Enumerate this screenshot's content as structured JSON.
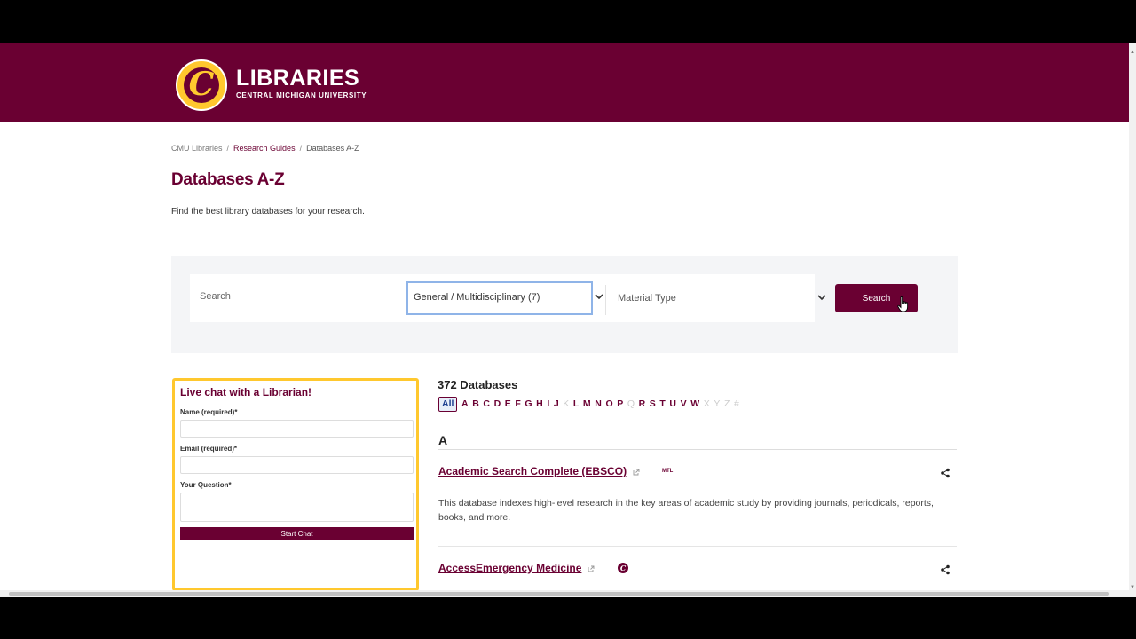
{
  "header": {
    "logo_glyph": "C",
    "title": "LIBRARIES",
    "subtitle": "CENTRAL MICHIGAN UNIVERSITY",
    "brand_color": "#6a0032",
    "accent_color": "#ffc82e"
  },
  "breadcrumb": {
    "home": "CMU Libraries",
    "parent": "Research Guides",
    "current": "Databases A-Z",
    "separator": "/"
  },
  "page": {
    "title": "Databases A-Z",
    "description": "Find the best library databases for your research."
  },
  "search": {
    "placeholder": "Search",
    "subject_value": "General / Multidisciplinary (7)",
    "material_type_value": "Material Type",
    "button_label": "Search"
  },
  "chat": {
    "title": "Live chat with a Librarian!",
    "name_label": "Name (required)*",
    "email_label": "Email (required)*",
    "question_label": "Your Question*",
    "button_label": "Start Chat"
  },
  "results": {
    "count_label": "372 Databases",
    "az_letters": [
      {
        "letter": "All",
        "state": "active"
      },
      {
        "letter": "A",
        "state": "enabled"
      },
      {
        "letter": "B",
        "state": "enabled"
      },
      {
        "letter": "C",
        "state": "enabled"
      },
      {
        "letter": "D",
        "state": "enabled"
      },
      {
        "letter": "E",
        "state": "enabled"
      },
      {
        "letter": "F",
        "state": "enabled"
      },
      {
        "letter": "G",
        "state": "enabled"
      },
      {
        "letter": "H",
        "state": "enabled"
      },
      {
        "letter": "I",
        "state": "enabled"
      },
      {
        "letter": "J",
        "state": "enabled"
      },
      {
        "letter": "K",
        "state": "disabled"
      },
      {
        "letter": "L",
        "state": "enabled"
      },
      {
        "letter": "M",
        "state": "enabled"
      },
      {
        "letter": "N",
        "state": "enabled"
      },
      {
        "letter": "O",
        "state": "enabled"
      },
      {
        "letter": "P",
        "state": "enabled"
      },
      {
        "letter": "Q",
        "state": "disabled"
      },
      {
        "letter": "R",
        "state": "enabled"
      },
      {
        "letter": "S",
        "state": "enabled"
      },
      {
        "letter": "T",
        "state": "enabled"
      },
      {
        "letter": "U",
        "state": "enabled"
      },
      {
        "letter": "V",
        "state": "enabled"
      },
      {
        "letter": "W",
        "state": "enabled"
      },
      {
        "letter": "X",
        "state": "disabled"
      },
      {
        "letter": "Y",
        "state": "disabled"
      },
      {
        "letter": "Z",
        "state": "disabled"
      },
      {
        "letter": "#",
        "state": "disabled"
      }
    ],
    "section_letter": "A",
    "databases": [
      {
        "title": "Academic Search Complete (EBSCO)",
        "badge": "MTL",
        "description": "This database indexes high-level research in the key areas of academic study by providing journals, periodicals, reports, books, and more."
      },
      {
        "title": "AccessEmergency Medicine",
        "badge": "C",
        "description": ""
      }
    ]
  }
}
